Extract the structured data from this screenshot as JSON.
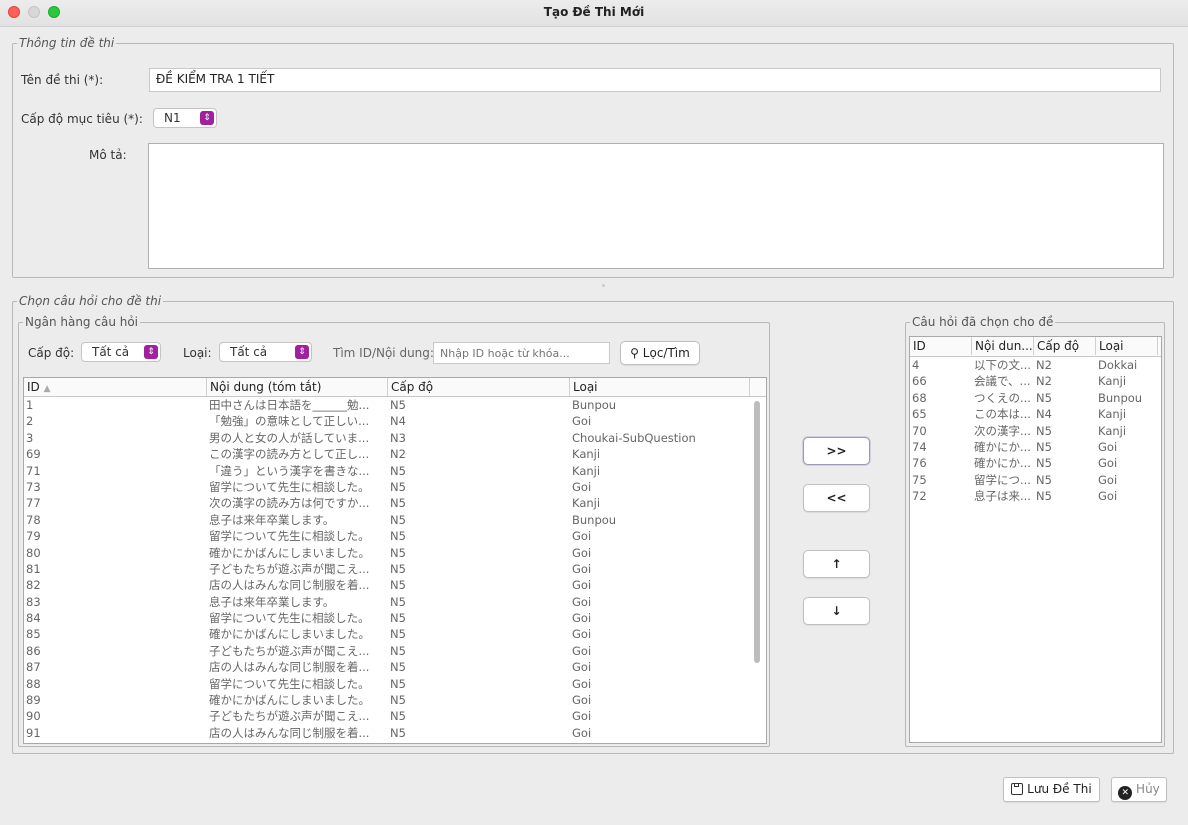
{
  "window": {
    "title": "Tạo Đề Thi Mới"
  },
  "info_group": {
    "legend": "Thông tin đề thi",
    "name_label": "Tên đề thi (*):",
    "name_value": "ĐỀ KIỂM TRA 1 TIẾT",
    "level_label": "Cấp độ mục tiêu (*):",
    "level_value": "N1",
    "desc_label": "Mô tả:"
  },
  "select_group": {
    "legend": "Chọn câu hỏi cho đề thi"
  },
  "bank": {
    "legend": "Ngân hàng câu hỏi",
    "level_label": "Cấp độ:",
    "level_value": "Tất cả",
    "type_label": "Loại:",
    "type_value": "Tất cả",
    "search_label": "Tìm ID/Nội dung:",
    "search_placeholder": "Nhập ID hoặc từ khóa...",
    "filter_button": "Lọc/Tìm",
    "columns": [
      "ID",
      "Nội dung (tóm tắt)",
      "Cấp độ",
      "Loại"
    ],
    "sort_indicator": "▲",
    "rows": [
      [
        "1",
        "田中さんは日本語を______勉...",
        "N5",
        "Bunpou"
      ],
      [
        "2",
        "「勉強」の意味として正しい...",
        "N4",
        "Goi"
      ],
      [
        "3",
        "男の人と女の人が話していま...",
        "N3",
        "Choukai-SubQuestion"
      ],
      [
        "69",
        "この漢字の読み方として正し...",
        "N2",
        "Kanji"
      ],
      [
        "71",
        "「違う」という漢字を書きな...",
        "N5",
        "Kanji"
      ],
      [
        "73",
        "留学について先生に相談した。",
        "N5",
        "Goi"
      ],
      [
        "77",
        "次の漢字の読み方は何ですか...",
        "N5",
        "Kanji"
      ],
      [
        "78",
        "息子は来年卒業します。",
        "N5",
        "Bunpou"
      ],
      [
        "79",
        "留学について先生に相談した。",
        "N5",
        "Goi"
      ],
      [
        "80",
        "確かにかばんにしまいました。",
        "N5",
        "Goi"
      ],
      [
        "81",
        "子どもたちが遊ぶ声が聞こえ...",
        "N5",
        "Goi"
      ],
      [
        "82",
        "店の人はみんな同じ制服を着...",
        "N5",
        "Goi"
      ],
      [
        "83",
        "息子は来年卒業します。",
        "N5",
        "Goi"
      ],
      [
        "84",
        "留学について先生に相談した。",
        "N5",
        "Goi"
      ],
      [
        "85",
        "確かにかばんにしまいました。",
        "N5",
        "Goi"
      ],
      [
        "86",
        "子どもたちが遊ぶ声が聞こえ...",
        "N5",
        "Goi"
      ],
      [
        "87",
        "店の人はみんな同じ制服を着...",
        "N5",
        "Goi"
      ],
      [
        "88",
        "留学について先生に相談した。",
        "N5",
        "Goi"
      ],
      [
        "89",
        "確かにかばんにしまいました。",
        "N5",
        "Goi"
      ],
      [
        "90",
        "子どもたちが遊ぶ声が聞こえ...",
        "N5",
        "Goi"
      ],
      [
        "91",
        "店の人はみんな同じ制服を着...",
        "N5",
        "Goi"
      ]
    ]
  },
  "transfer": {
    "add": ">>",
    "remove": "<<",
    "up": "↑",
    "down": "↓"
  },
  "selected": {
    "legend": "Câu hỏi đã chọn cho đề",
    "columns": [
      "ID",
      "Nội dun...",
      "Cấp độ",
      "Loại"
    ],
    "rows": [
      [
        "4",
        "以下の文...",
        "N2",
        "Dokkai"
      ],
      [
        "66",
        "会議で、...",
        "N2",
        "Kanji"
      ],
      [
        "68",
        "つくえの...",
        "N5",
        "Bunpou"
      ],
      [
        "65",
        "この本は...",
        "N4",
        "Kanji"
      ],
      [
        "70",
        "次の漢字...",
        "N5",
        "Kanji"
      ],
      [
        "74",
        "確かにか...",
        "N5",
        "Goi"
      ],
      [
        "76",
        "確かにか...",
        "N5",
        "Goi"
      ],
      [
        "75",
        "留学につ...",
        "N5",
        "Goi"
      ],
      [
        "72",
        "息子は来...",
        "N5",
        "Goi"
      ]
    ]
  },
  "footer": {
    "save": "Lưu Đề Thi",
    "cancel": "Hủy"
  },
  "colors": {
    "accent_purple": "#a020a0",
    "close": "#fe5f57",
    "maximize": "#28c840"
  },
  "icons": {
    "save": "floppy-disk-icon",
    "cancel": "close-circle-icon",
    "search": "search-icon"
  }
}
